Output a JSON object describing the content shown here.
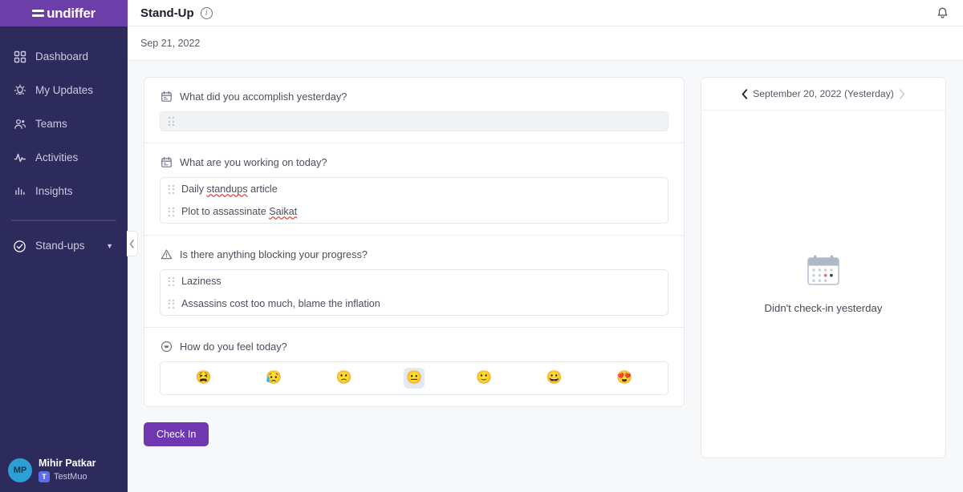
{
  "sidebar": {
    "logo": {
      "text": "undiffer",
      "icon": "equals-bars-logo"
    },
    "items": [
      {
        "label": "Dashboard",
        "icon": "grid-dashboard-icon"
      },
      {
        "label": "My Updates",
        "icon": "lightbulb-icon"
      },
      {
        "label": "Teams",
        "icon": "people-icon"
      },
      {
        "label": "Activities",
        "icon": "activity-pulse-icon"
      },
      {
        "label": "Insights",
        "icon": "bar-chart-icon"
      }
    ],
    "section": {
      "label": "Stand-ups",
      "icon": "check-circle-icon",
      "caret": "▼"
    },
    "user": {
      "initials": "MP",
      "name": "Mihir Patkar",
      "team_initial": "T",
      "team_name": "TestMuo"
    }
  },
  "header": {
    "title": "Stand-Up",
    "info_icon": "info-icon",
    "bell_icon": "notification-bell-icon",
    "date": "Sep 21, 2022"
  },
  "collapse_tab": {
    "icon": "chevron-left-icon"
  },
  "standup": {
    "questions": [
      {
        "icon": "clipboard-calendar-icon",
        "text": "What did you accomplish yesterday?",
        "empty": true,
        "placeholder": "",
        "answers": []
      },
      {
        "icon": "clipboard-calendar-icon",
        "text": "What are you working on today?",
        "empty": false,
        "answers": [
          {
            "pre": "Daily ",
            "misspelled": "standups",
            "post": " article"
          },
          {
            "pre": "Plot to assassinate ",
            "misspelled": "Saikat",
            "post": ""
          }
        ]
      },
      {
        "icon": "warning-triangle-icon",
        "text": "Is there anything blocking your progress?",
        "empty": false,
        "answers": [
          {
            "pre": "Laziness",
            "misspelled": "",
            "post": ""
          },
          {
            "pre": "Assassins cost too much, blame the inflation",
            "misspelled": "",
            "post": ""
          }
        ]
      }
    ],
    "mood": {
      "icon": "mood-circle-icon",
      "text": "How do you feel today?",
      "options": [
        {
          "emoji": "😫",
          "name": "mood-anguished",
          "selected": false
        },
        {
          "emoji": "😥",
          "name": "mood-sad",
          "selected": false
        },
        {
          "emoji": "🙁",
          "name": "mood-slightly-frowning",
          "selected": false
        },
        {
          "emoji": "😐",
          "name": "mood-neutral",
          "selected": true
        },
        {
          "emoji": "🙂",
          "name": "mood-slightly-smiling",
          "selected": false
        },
        {
          "emoji": "😀",
          "name": "mood-grinning",
          "selected": false
        },
        {
          "emoji": "😍",
          "name": "mood-heart-eyes",
          "selected": false
        }
      ]
    },
    "check_in_label": "Check In"
  },
  "side_panel": {
    "prev_icon": "chevron-left-icon",
    "next_icon": "chevron-right-icon",
    "date_label": "September 20, 2022 (Yesterday)",
    "empty_icon": "calendar-illustration",
    "empty_text": "Didn't check-in yesterday"
  },
  "colors": {
    "brand_purple": "#6f38b0",
    "logo_purple": "#6c3fa8",
    "sidebar_navy": "#2d2a5c",
    "canvas": "#f7f8fa",
    "spellcheck_red": "#e0443e",
    "selected_mood_bg": "#e4e9f1"
  }
}
